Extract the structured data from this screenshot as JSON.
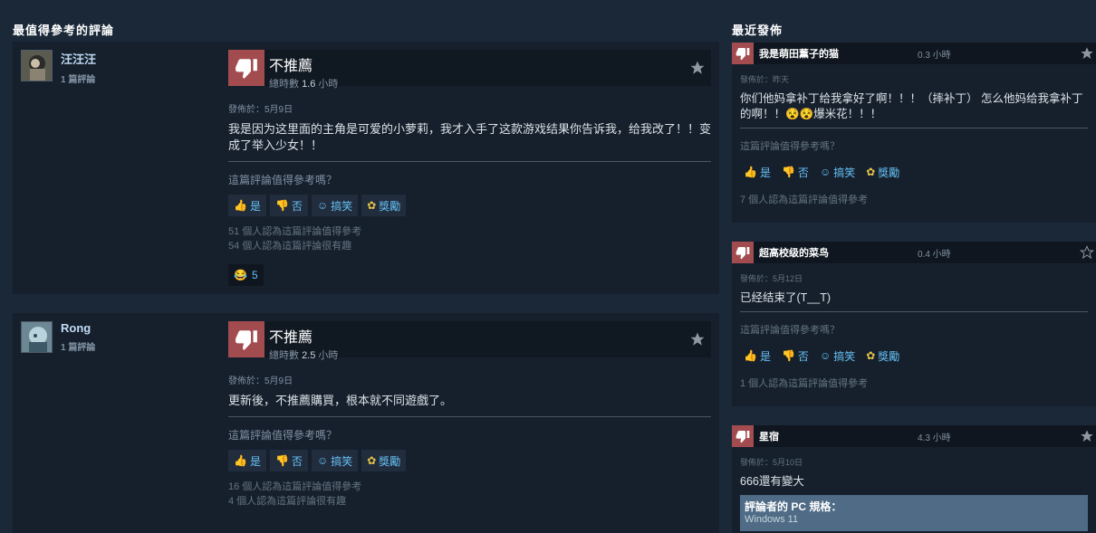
{
  "left_title": "最值得參考的評論",
  "right_title": "最近發佈",
  "reviews": [
    {
      "author": "汪汪汪",
      "count": "1 篇評論",
      "verdict": "不推薦",
      "hours_label": "總時數",
      "hours": "1.6",
      "hours_unit": "小時",
      "posted": "發佈於：5月9日",
      "content": "我是因为这里面的主角是可爱的小萝莉，我才入手了这款游戏结果你告诉我，给我改了！！变成了举入少女！！",
      "question": "這篇評論值得參考嗎？",
      "yes": "是",
      "no": "否",
      "funny": "搞笑",
      "award": "獎勵",
      "helpful": "51 個人認為這篇評論值得參考",
      "funny_count": "54 個人認為這篇評論很有趣",
      "reaction_count": "5"
    },
    {
      "author": "Rong",
      "count": "1 篇評論",
      "verdict": "不推薦",
      "hours_label": "總時數",
      "hours": "2.5",
      "hours_unit": "小時",
      "posted": "發佈於：5月9日",
      "content": "更新後，不推薦購買，根本就不同遊戲了。",
      "question": "這篇評論值得參考嗎？",
      "yes": "是",
      "no": "否",
      "funny": "搞笑",
      "award": "獎勵",
      "helpful": "16 個人認為這篇評論值得參考",
      "funny_count": "4 個人認為這篇評論很有趣"
    }
  ],
  "recent": [
    {
      "author": "我是萌田薰子的猫",
      "hours": "0.3 小時",
      "posted": "發佈於：昨天",
      "content": "你们他妈拿补丁给我拿好了啊！！！（摔补丁） 怎么他妈给我拿补丁的啊！！😵😵爆米花！！！",
      "question": "這篇評論值得參考嗎？",
      "yes": "是",
      "no": "否",
      "funny": "搞笑",
      "award": "獎勵",
      "helpful": "7 個人認為這篇評論值得參考"
    },
    {
      "author": "超高校级的菜鸟",
      "hours": "0.4 小時",
      "posted": "發佈於：5月12日",
      "content": "已经结束了(T__T)",
      "question": "這篇評論值得參考嗎？",
      "yes": "是",
      "no": "否",
      "funny": "搞笑",
      "award": "獎勵",
      "helpful": "1 個人認為這篇評論值得參考"
    },
    {
      "author": "星宿",
      "hours": "4.3 小時",
      "posted": "發佈於：5月10日",
      "content": "666還有變大",
      "specs_title": "評論者的 PC 規格：",
      "specs_os": "Windows 11"
    }
  ]
}
